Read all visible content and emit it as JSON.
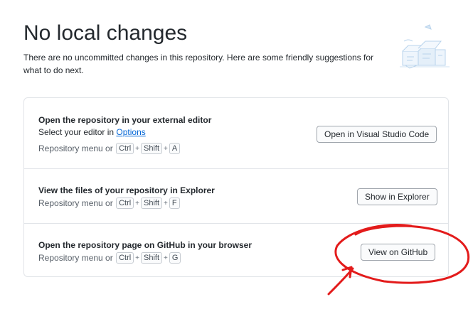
{
  "header": {
    "title": "No local changes",
    "subtitle": "There are no uncommitted changes in this repository. Here are some friendly suggestions for what to do next."
  },
  "suggestions": [
    {
      "title": "Open the repository in your external editor",
      "desc_prefix": "Select your editor in ",
      "desc_link": "Options",
      "shortcut_prefix": "Repository menu or",
      "keys": [
        "Ctrl",
        "Shift",
        "A"
      ],
      "button": "Open in Visual Studio Code"
    },
    {
      "title": "View the files of your repository in Explorer",
      "shortcut_prefix": "Repository menu or",
      "keys": [
        "Ctrl",
        "Shift",
        "F"
      ],
      "button": "Show in Explorer"
    },
    {
      "title": "Open the repository page on GitHub in your browser",
      "shortcut_prefix": "Repository menu or",
      "keys": [
        "Ctrl",
        "Shift",
        "G"
      ],
      "button": "View on GitHub"
    }
  ],
  "key_separator": "+",
  "colors": {
    "annotation": "#e31b1b",
    "link": "#0366d6",
    "border": "#e1e4e8"
  },
  "icons": {
    "illustration": "empty-boxes-illustration",
    "annotation": "hand-drawn-circle-arrow"
  }
}
